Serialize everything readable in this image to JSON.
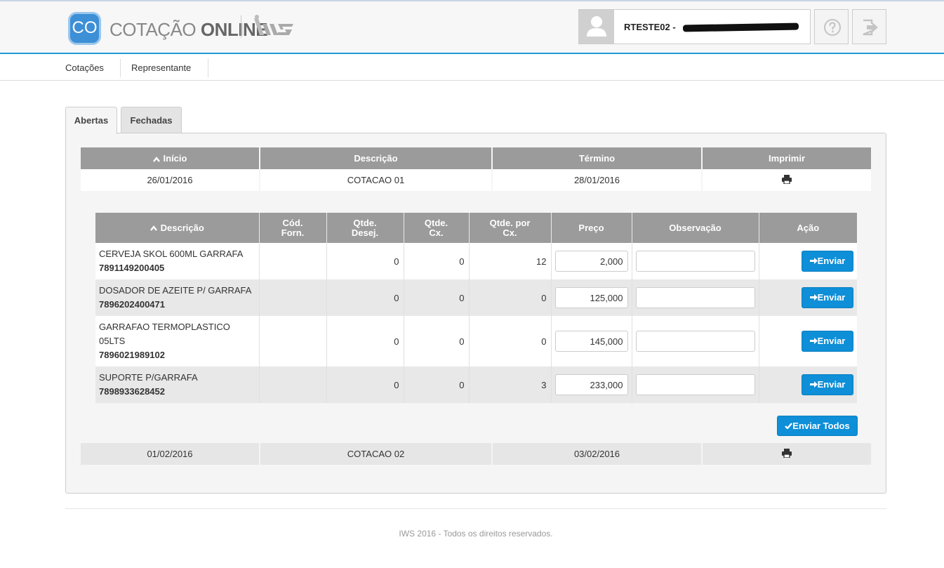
{
  "header": {
    "logo_abbr": "CO",
    "logo_light": "COTAÇÃO ",
    "logo_bold": "ONLINE",
    "user_name": "RTESTE02 -"
  },
  "nav": {
    "items": [
      {
        "label": "Cotações"
      },
      {
        "label": "Representante"
      }
    ]
  },
  "tabs": [
    {
      "label": "Abertas",
      "active": true
    },
    {
      "label": "Fechadas",
      "active": false
    }
  ],
  "outer_table": {
    "headers": [
      "Início",
      "Descrição",
      "Término",
      "Imprimir"
    ],
    "rows": [
      {
        "inicio": "26/01/2016",
        "descricao": "COTACAO 01",
        "termino": "28/01/2016"
      },
      {
        "inicio": "01/02/2016",
        "descricao": "COTACAO 02",
        "termino": "03/02/2016"
      }
    ]
  },
  "inner_table": {
    "headers": {
      "descricao": "Descrição",
      "cod_forn_1": "Cód.",
      "cod_forn_2": "Forn.",
      "qtde_desej_1": "Qtde.",
      "qtde_desej_2": "Desej.",
      "qtde_cx_1": "Qtde.",
      "qtde_cx_2": "Cx.",
      "qtde_por_cx_1": "Qtde. por",
      "qtde_por_cx_2": "Cx.",
      "preco": "Preço",
      "observacao": "Observação",
      "acao": "Ação"
    },
    "rows": [
      {
        "name": "CERVEJA SKOL 600ML GARRAFA",
        "code": "7891149200405",
        "cod_forn": "",
        "qtde_desej": "0",
        "qtde_cx": "0",
        "qtde_por_cx": "12",
        "preco": "2,000",
        "observacao": "",
        "action": "Enviar"
      },
      {
        "name": "DOSADOR DE AZEITE P/ GARRAFA",
        "code": "7896202400471",
        "cod_forn": "",
        "qtde_desej": "0",
        "qtde_cx": "0",
        "qtde_por_cx": "0",
        "preco": "125,000",
        "observacao": "",
        "action": "Enviar"
      },
      {
        "name_line1": "GARRAFAO TERMOPLASTICO",
        "name_line2": "05LTS",
        "code": "7896021989102",
        "cod_forn": "",
        "qtde_desej": "0",
        "qtde_cx": "0",
        "qtde_por_cx": "0",
        "preco": "145,000",
        "observacao": "",
        "action": "Enviar"
      },
      {
        "name": "SUPORTE P/GARRAFA",
        "code": "7898933628452",
        "cod_forn": "",
        "qtde_desej": "0",
        "qtde_cx": "0",
        "qtde_por_cx": "3",
        "preco": "233,000",
        "observacao": "",
        "action": "Enviar"
      }
    ],
    "send_all": "Enviar Todos"
  },
  "footer": {
    "text": "IWS 2016 - Todos os direitos reservados."
  },
  "colors": {
    "accent": "#1e9ad6",
    "button_blue": "#0e8fd8",
    "table_header": "#9b9b9b"
  },
  "icons": [
    "user-avatar-icon",
    "help-icon",
    "logout-icon",
    "sort-up-icon",
    "print-icon",
    "arrow-right-icon",
    "check-icon"
  ]
}
